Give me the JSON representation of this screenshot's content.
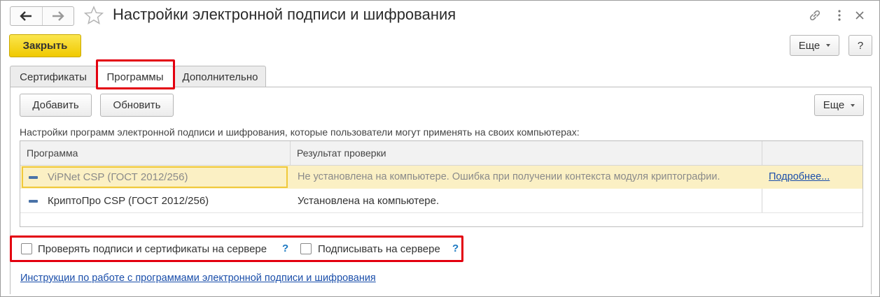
{
  "window": {
    "title": "Настройки электронной подписи и шифрования"
  },
  "icons": {
    "back": "arrow-left-icon",
    "forward": "arrow-right-icon",
    "favorite": "star-icon",
    "link": "link-icon",
    "menu": "vertical-dots-icon",
    "close": "close-icon"
  },
  "toolbar": {
    "close_label": "Закрыть",
    "more_label": "Еще",
    "help_label": "?"
  },
  "tabs": [
    {
      "label": "Сертификаты"
    },
    {
      "label": "Программы",
      "active": true
    },
    {
      "label": "Дополнительно"
    }
  ],
  "programs": {
    "add_label": "Добавить",
    "refresh_label": "Обновить",
    "more_label": "Еще",
    "description": "Настройки программ электронной подписи и шифрования, которые пользователи могут применять на своих компьютерах:",
    "columns": [
      "Программа",
      "Результат проверки"
    ],
    "rows": [
      {
        "program": "ViPNet CSP (ГОСТ 2012/256)",
        "result": "Не установлена на компьютере. Ошибка при получении контекста модуля криптографии.",
        "link": "Подробнее...",
        "selected": true
      },
      {
        "program": "КриптоПро CSP (ГОСТ 2012/256)",
        "result": "Установлена на компьютере.",
        "link": ""
      }
    ]
  },
  "options": {
    "verify_on_server": {
      "label": "Проверять подписи и сертификаты на сервере",
      "checked": false,
      "help": "?"
    },
    "sign_on_server": {
      "label": "Подписывать на сервере",
      "checked": false,
      "help": "?"
    }
  },
  "instructions_link": "Инструкции по работе с программами электронной подписи и шифрования",
  "colors": {
    "accent_yellow": "#f4d31c",
    "highlight_red": "#e3000f",
    "selected_row": "#fbf0c4",
    "link": "#1a4eaa"
  }
}
